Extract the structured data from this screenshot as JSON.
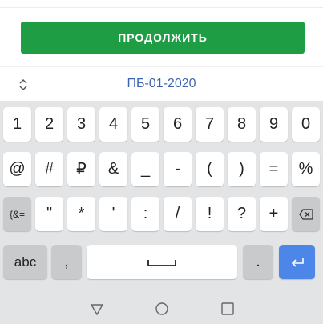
{
  "continue_button": {
    "label": "ПРОДОЛЖИТЬ",
    "color": "#1f9d45"
  },
  "picker": {
    "icon": "up-down-chevron-icon",
    "value": "ПБ-01-2020",
    "value_color": "#3f64b5"
  },
  "keyboard": {
    "row1": [
      "1",
      "2",
      "3",
      "4",
      "5",
      "6",
      "7",
      "8",
      "9",
      "0"
    ],
    "row2": [
      "@",
      "#",
      "₽",
      "&",
      "_",
      "-",
      "(",
      ")",
      "=",
      "%"
    ],
    "row3": {
      "shift_label": "{&=",
      "keys": [
        "\"",
        "*",
        "'",
        ":",
        "/",
        "!",
        "?",
        "+"
      ],
      "backspace_icon": "backspace-icon"
    },
    "row4": {
      "abc_label": "abc",
      "comma_label": ",",
      "space_icon": "spacebar-icon",
      "period_label": ".",
      "enter_icon": "enter-icon",
      "enter_color": "#4c86e8"
    }
  },
  "navbar": {
    "back_icon": "back-triangle-icon",
    "home_icon": "home-circle-icon",
    "recents_icon": "recents-square-icon"
  }
}
